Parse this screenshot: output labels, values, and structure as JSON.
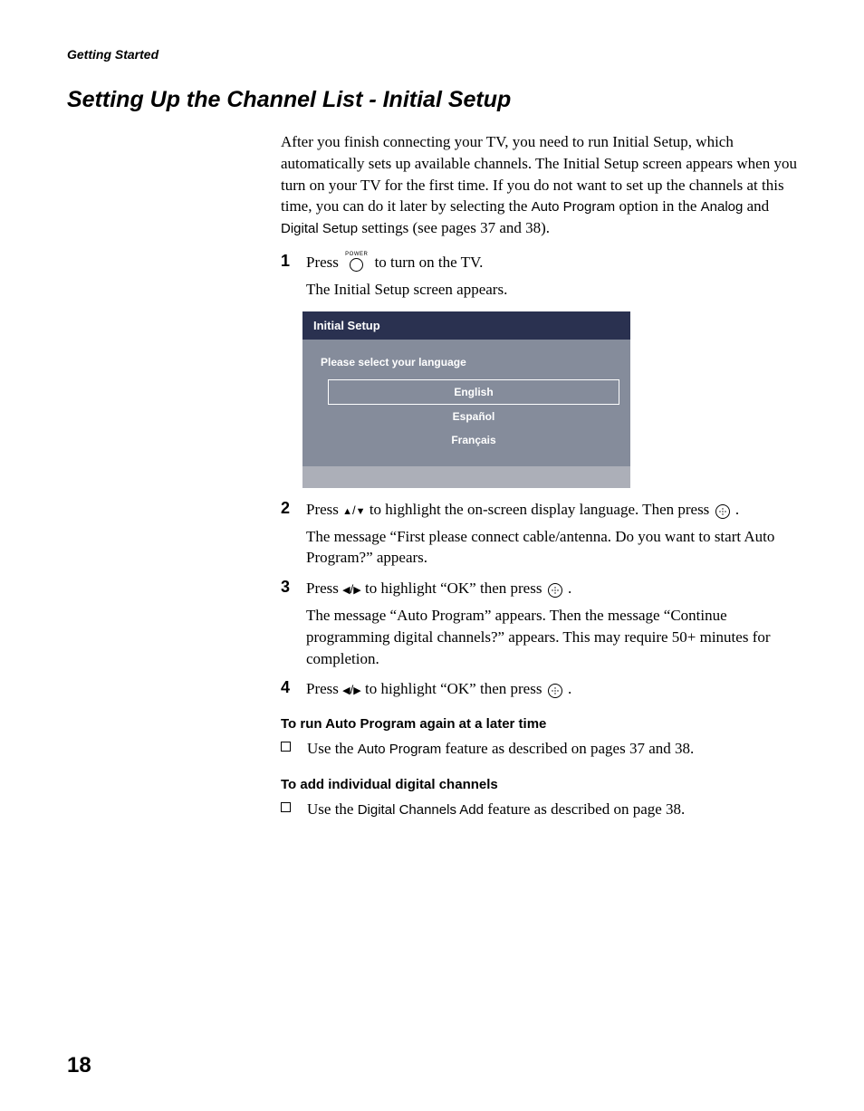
{
  "header": {
    "section": "Getting Started"
  },
  "title": "Setting Up the Channel List - Initial Setup",
  "intro": {
    "part1": "After you finish connecting your TV, you need to run Initial Setup, which automatically sets up available channels. The Initial Setup screen appears when you turn on your TV for the first time. If you do not want to set up the channels at this time, you can do it later by selecting the ",
    "auto_program": "Auto Program",
    "part2": " option in the ",
    "analog": "Analog",
    "and": " and ",
    "digital_setup": "Digital Setup",
    "part3": " settings (see pages 37 and 38)."
  },
  "step1": {
    "num": "1",
    "pre": "Press ",
    "power_label": "POWER",
    "post": " to turn on the TV.",
    "sub": "The Initial Setup screen appears."
  },
  "tv_menu": {
    "title": "Initial Setup",
    "prompt": "Please select your language",
    "options": [
      "English",
      "Español",
      "Français"
    ]
  },
  "step2": {
    "num": "2",
    "pre": "Press ",
    "arrows": "↑/↓",
    "mid": " to highlight the on-screen display language. Then press ",
    "dot": ".",
    "sub": "The message “First please connect cable/antenna. Do you want to start Auto Program?” appears."
  },
  "step3": {
    "num": "3",
    "pre": "Press ",
    "arrows": "←/→",
    "mid": " to highlight “OK” then press ",
    "dot": ".",
    "sub": "The message “Auto Program” appears.  Then the message “Continue programming digital channels?” appears. This may require 50+ minutes for completion."
  },
  "step4": {
    "num": "4",
    "pre": "Press ",
    "arrows": "←/→",
    "mid": " to highlight “OK” then press ",
    "dot": "."
  },
  "sub_section1": {
    "heading": "To run Auto Program again at a later time",
    "bullet_pre": "Use the ",
    "feature": "Auto Program",
    "bullet_post": " feature as described on pages 37 and 38."
  },
  "sub_section2": {
    "heading": "To add individual digital channels",
    "bullet_pre": "Use the ",
    "feature": "Digital Channels Add",
    "bullet_post": " feature as described on page 38."
  },
  "plus_glyph": "···",
  "page_number": "18"
}
